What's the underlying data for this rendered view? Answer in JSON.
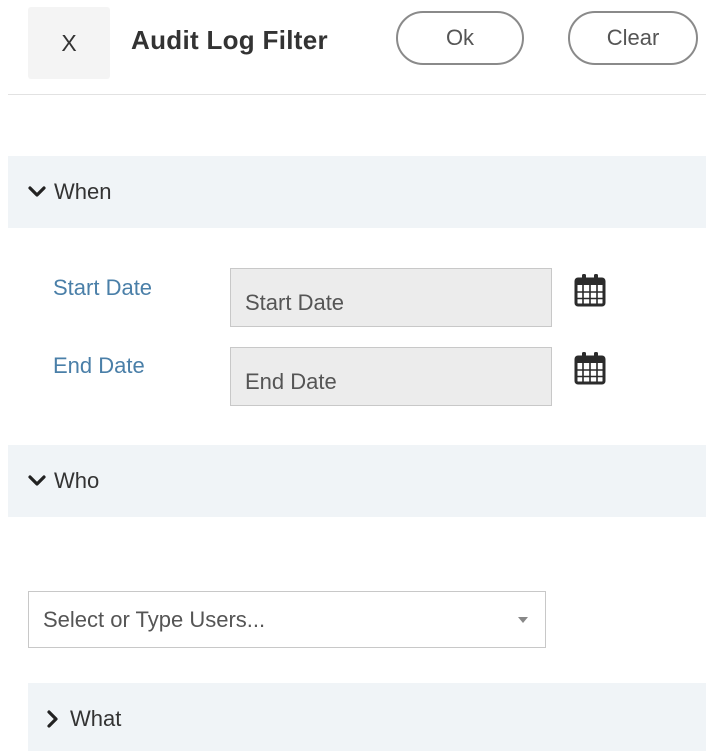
{
  "header": {
    "close_label": "X",
    "title": "Audit Log Filter",
    "ok_label": "Ok",
    "clear_label": "Clear"
  },
  "sections": {
    "when": {
      "label": "When",
      "expanded": true,
      "icon": "chevron-down-icon"
    },
    "who": {
      "label": "Who",
      "expanded": true,
      "icon": "chevron-down-icon"
    },
    "what": {
      "label": "What",
      "expanded": false,
      "icon": "chevron-right-icon"
    }
  },
  "when_fields": {
    "start_label": "Start Date",
    "start_placeholder": "Start Date",
    "start_value": "",
    "end_label": "End Date",
    "end_placeholder": "End Date",
    "end_value": "",
    "calendar_icon": "calendar-icon"
  },
  "who_fields": {
    "users_placeholder": "Select or Type Users..."
  },
  "colors": {
    "accent_label": "#4a7fa8",
    "section_bg": "#f0f4f7",
    "input_bg": "#ececec"
  }
}
